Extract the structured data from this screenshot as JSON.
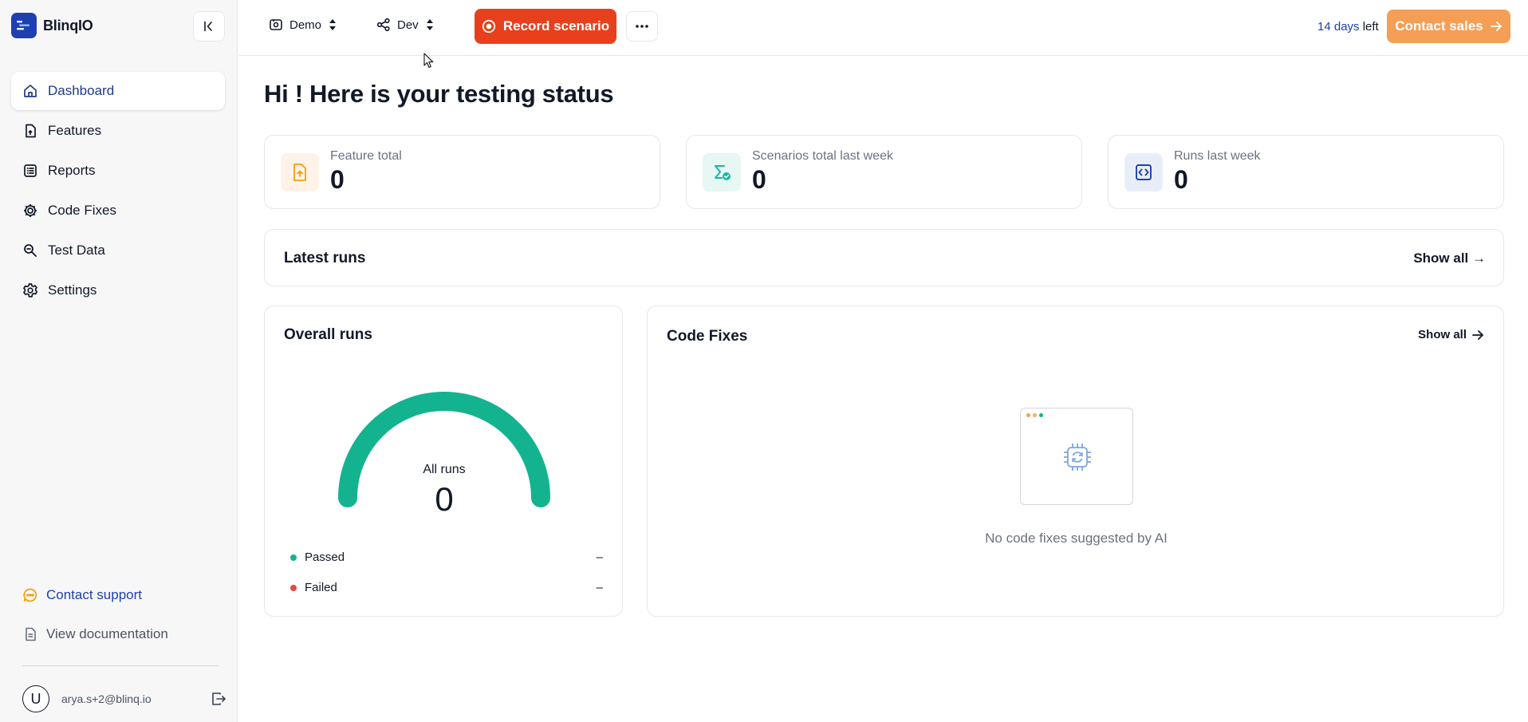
{
  "brand": {
    "name": "BlinqIO",
    "color": "#1e40af"
  },
  "sidebar": {
    "items": [
      {
        "label": "Dashboard",
        "icon": "home-icon",
        "active": true
      },
      {
        "label": "Features",
        "icon": "feature-file-icon",
        "active": false
      },
      {
        "label": "Reports",
        "icon": "list-report-icon",
        "active": false
      },
      {
        "label": "Code Fixes",
        "icon": "code-fix-gear-icon",
        "active": false
      },
      {
        "label": "Test Data",
        "icon": "search-data-icon",
        "active": false
      },
      {
        "label": "Settings",
        "icon": "gear-icon",
        "active": false
      }
    ],
    "support_label": "Contact support",
    "docs_label": "View documentation",
    "user": {
      "initial": "U",
      "email": "arya.s+2@blinq.io"
    }
  },
  "topbar": {
    "project": "Demo",
    "environment": "Dev",
    "record_label": "Record scenario",
    "trial_days": "14 days",
    "trial_suffix": "left",
    "contact_sales_label": "Contact sales"
  },
  "main": {
    "title": "Hi ! Here is your testing status",
    "stats": [
      {
        "label": "Feature total",
        "value": "0",
        "icon": "file-upload-icon",
        "color": "#f59e0b"
      },
      {
        "label": "Scenarios total last week",
        "value": "0",
        "icon": "sigma-check-icon",
        "color": "#14b8a6"
      },
      {
        "label": "Runs last week",
        "value": "0",
        "icon": "code-brackets-icon",
        "color": "#1e40af"
      }
    ],
    "latest_runs": {
      "title": "Latest runs",
      "show_all": "Show all →"
    },
    "overall_runs": {
      "title": "Overall runs",
      "gauge_label": "All runs",
      "gauge_value": "0",
      "gauge_color": "#13b38f",
      "legend": [
        {
          "label": "Passed",
          "value": "–",
          "color": "#13b38f"
        },
        {
          "label": "Failed",
          "value": "–",
          "color": "#ef4444"
        }
      ]
    },
    "code_fixes": {
      "title": "Code Fixes",
      "show_all": "Show all",
      "empty_text": "No code fixes suggested by AI"
    }
  }
}
